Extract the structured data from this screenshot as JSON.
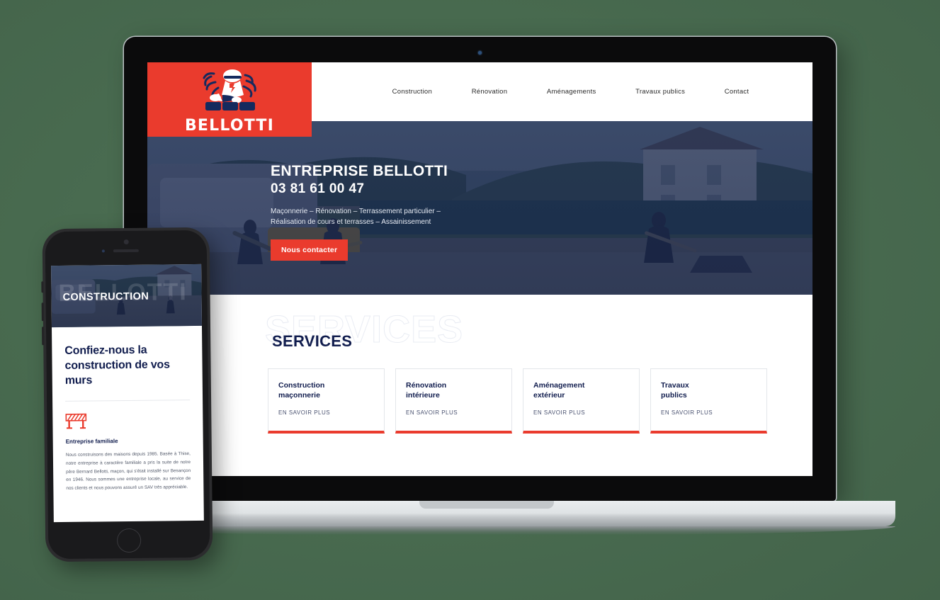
{
  "site": {
    "brand": "BELLOTTI",
    "logo_icon": "mason-laying-bricks-icon",
    "accent_red": "#ea3b2d",
    "navy": "#111d4e",
    "backdrop_green": "#4a6a51"
  },
  "nav": {
    "items": [
      {
        "label": "Construction"
      },
      {
        "label": "Rénovation"
      },
      {
        "label": "Aménagements"
      },
      {
        "label": "Travaux publics"
      },
      {
        "label": "Contact"
      }
    ]
  },
  "hero": {
    "title": "ENTREPRISE BELLOTTI",
    "phone": "03 81 61 00 47",
    "subtitle_line1": "Maçonnerie – Rénovation – Terrassement particulier –",
    "subtitle_line2": "Réalisation de cours et terrasses – Assainissement",
    "cta_label": "Nous contacter"
  },
  "services": {
    "ghost_title": "SERVICES",
    "title": "SERVICES",
    "cards": [
      {
        "title": "Construction\nmaçonnerie",
        "link": "EN SAVOIR PLUS"
      },
      {
        "title": "Rénovation\nintérieure",
        "link": "EN SAVOIR PLUS"
      },
      {
        "title": "Aménagement\nextérieur",
        "link": "EN SAVOIR PLUS"
      },
      {
        "title": "Travaux\npublics",
        "link": "EN SAVOIR PLUS"
      }
    ]
  },
  "phone_view": {
    "hero_ghost": "BELLOTTI",
    "hero_title": "CONSTRUCTION",
    "heading": "Confiez-nous la construction de vos murs",
    "icon": "construction-barrier-icon",
    "subheading": "Entreprise familiale",
    "body": "Nous construisons des maisons depuis 1985. Basée à Thise, notre entreprise à caractère familiale a pris la suite de notre père Bernard Bellotti, maçon, qui s'était installé sur Besançon en 1946. Nous sommes une entreprise locale, au service de nos clients et nous pouvons assuré un SAV très appréciable."
  }
}
